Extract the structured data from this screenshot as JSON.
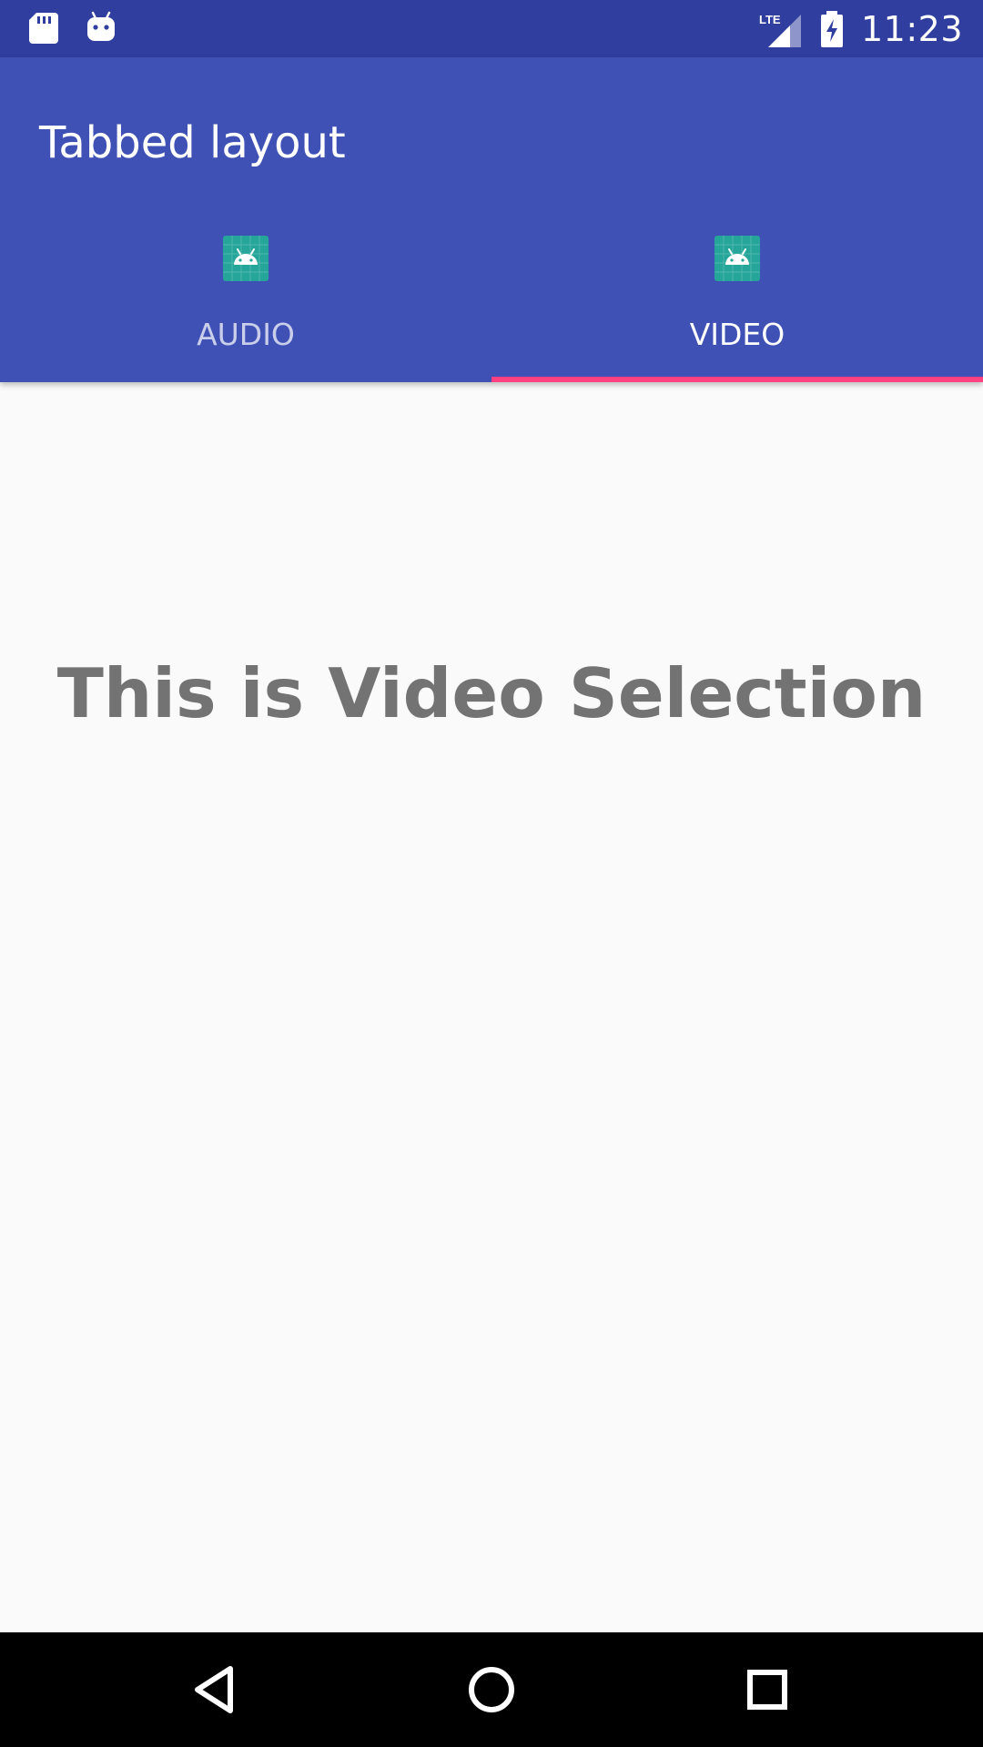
{
  "status_bar": {
    "left_icons": [
      "sd-card-icon",
      "android-notification-icon"
    ],
    "network_type": "LTE",
    "time": "11:23"
  },
  "app_bar": {
    "title": "Tabbed layout",
    "color": "#3f51b5"
  },
  "tabs": [
    {
      "label": "AUDIO",
      "icon": "android-icon",
      "selected": false
    },
    {
      "label": "VIDEO",
      "icon": "android-icon",
      "selected": true
    }
  ],
  "tab_indicator_color": "#ff4081",
  "content": {
    "text": "This is Video Selection"
  },
  "nav_bar": {
    "buttons": [
      "back-icon",
      "home-icon",
      "recents-icon"
    ]
  }
}
